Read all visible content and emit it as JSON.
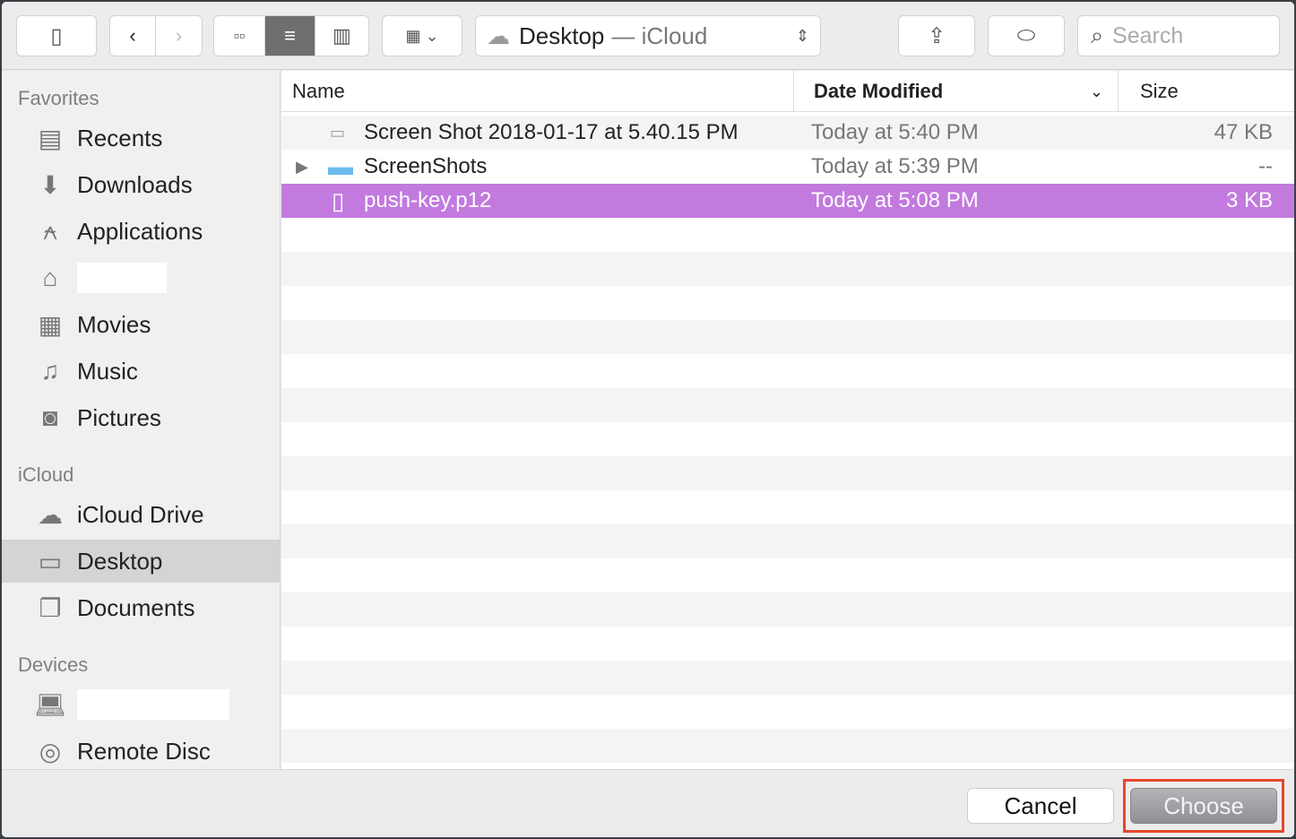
{
  "toolbar": {
    "path_folder": "Desktop",
    "path_location": "— iCloud",
    "search_placeholder": "Search"
  },
  "sidebar": {
    "favorites_header": "Favorites",
    "favorites": [
      {
        "label": "Recents",
        "icon": "recents-icon"
      },
      {
        "label": "Downloads",
        "icon": "downloads-icon"
      },
      {
        "label": "Applications",
        "icon": "applications-icon"
      },
      {
        "label": "",
        "icon": "home-icon"
      },
      {
        "label": "Movies",
        "icon": "movies-icon"
      },
      {
        "label": "Music",
        "icon": "music-icon"
      },
      {
        "label": "Pictures",
        "icon": "pictures-icon"
      }
    ],
    "icloud_header": "iCloud",
    "icloud": [
      {
        "label": "iCloud Drive"
      },
      {
        "label": "Desktop"
      },
      {
        "label": "Documents"
      }
    ],
    "devices_header": "Devices",
    "devices": [
      {
        "label": ""
      },
      {
        "label": "Remote Disc"
      }
    ]
  },
  "columns": {
    "name": "Name",
    "date": "Date Modified",
    "size": "Size"
  },
  "files": [
    {
      "name": "Screen Shot 2018-01-17 at 5.40.15 PM",
      "date": "Today at 5:40 PM",
      "size": "47 KB"
    },
    {
      "name": "ScreenShots",
      "date": "Today at 5:39 PM",
      "size": "--"
    },
    {
      "name": "push-key.p12",
      "date": "Today at 5:08 PM",
      "size": "3 KB"
    }
  ],
  "footer": {
    "cancel": "Cancel",
    "choose": "Choose"
  },
  "colors": {
    "selection": "#c27ade",
    "highlight": "#e8452c"
  }
}
